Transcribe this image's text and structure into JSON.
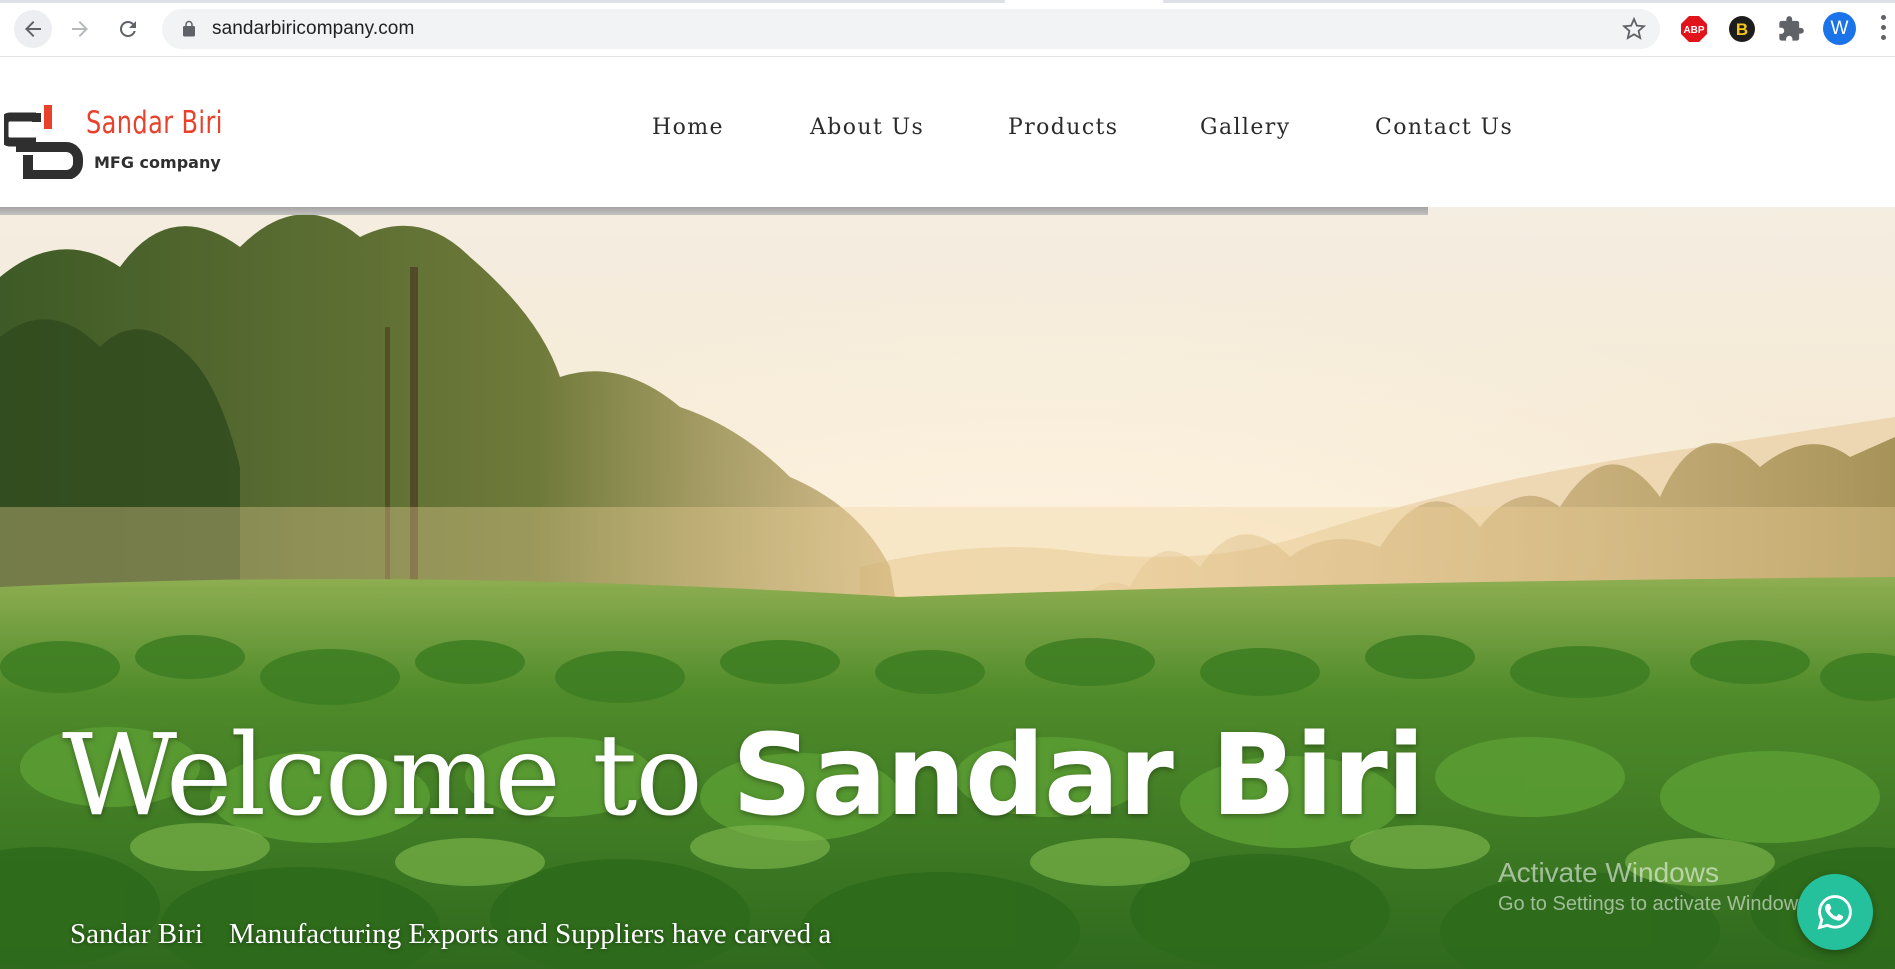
{
  "browser": {
    "url": "sandarbiricompany.com",
    "profile_initial": "W",
    "extensions": [
      "adblock-plus",
      "b-extension",
      "extensions-puzzle"
    ]
  },
  "site": {
    "logo": {
      "name": "Sandar Biri",
      "tagline": "MFG company",
      "accent_color": "#e8412c"
    },
    "nav": [
      "Home",
      "About Us",
      "Products",
      "Gallery",
      "Contact Us"
    ]
  },
  "hero": {
    "title_part1": "Welcome to",
    "title_part2": "Sandar Biri",
    "subtitle_brand": "Sandar Biri",
    "subtitle_text": "Manufacturing Exports and Suppliers have carved a"
  },
  "overlay": {
    "activate_title": "Activate Windows",
    "activate_sub": "Go to Settings to activate Windows."
  },
  "colors": {
    "whatsapp": "#25c19c",
    "profile": "#1a73e8"
  }
}
